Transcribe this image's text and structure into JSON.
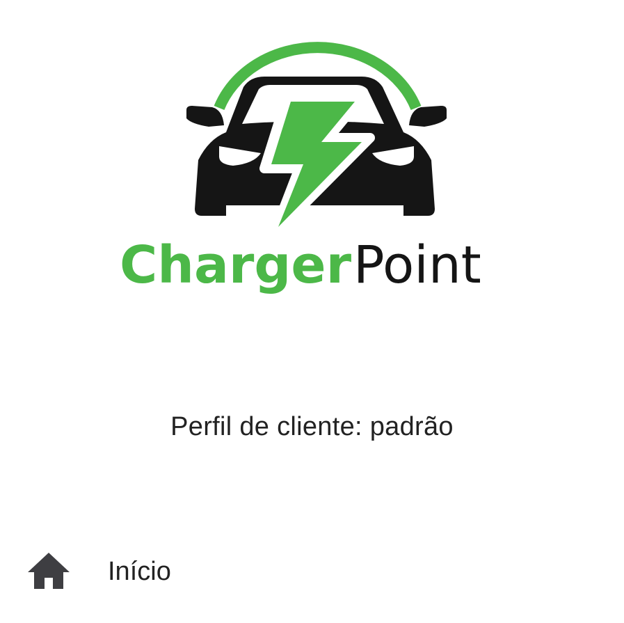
{
  "brand": {
    "name_part1": "Charger",
    "name_part2": "Point",
    "logo_icon": "car-charging-icon",
    "colors": {
      "green": "#4cb848",
      "dark": "#151515"
    }
  },
  "profile": {
    "text": "Perfil de cliente: padrão"
  },
  "nav": {
    "home_icon": "home-icon",
    "home_label": "Início"
  }
}
